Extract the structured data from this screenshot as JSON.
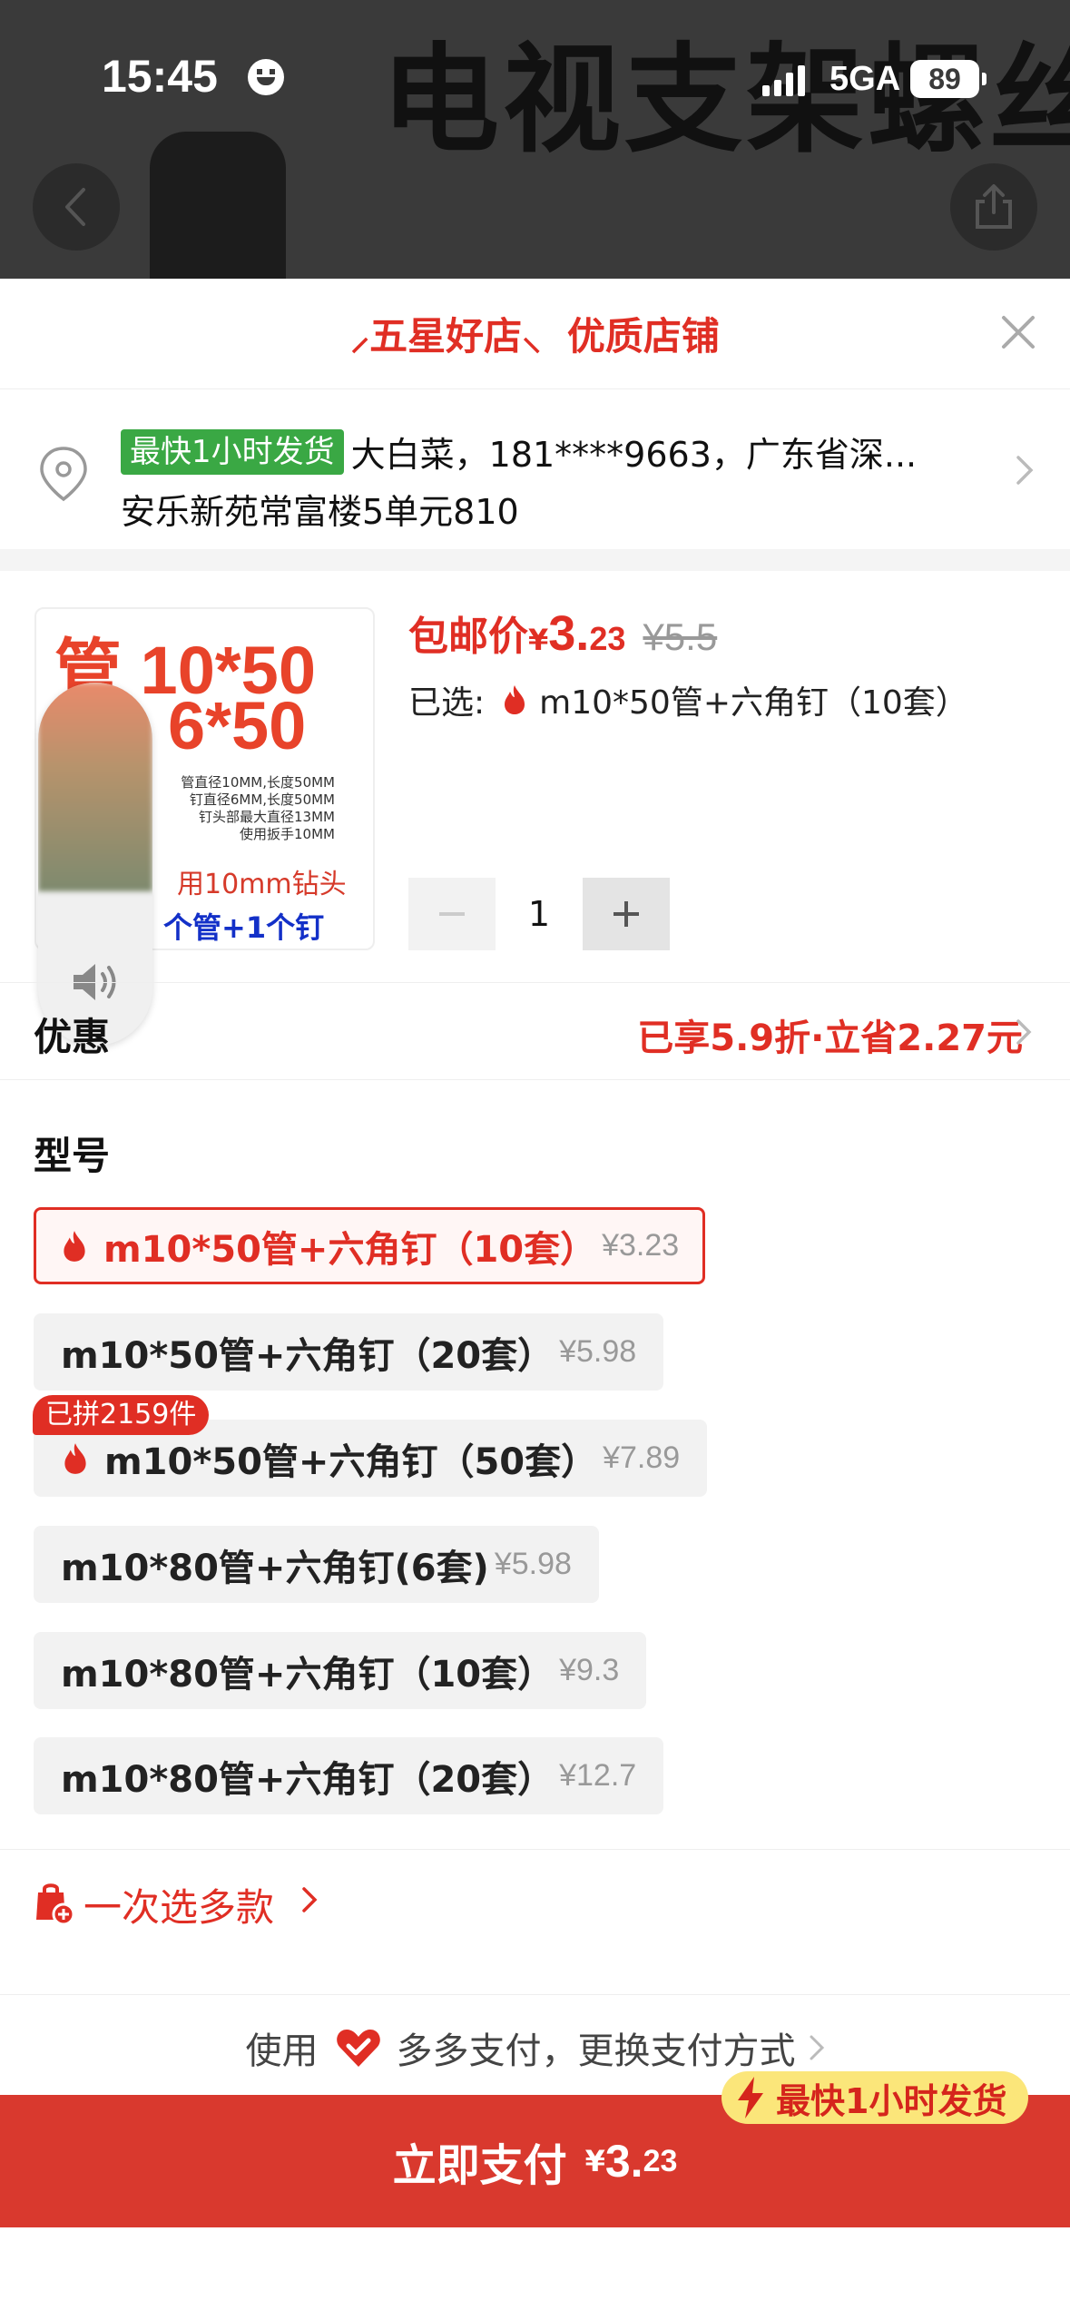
{
  "status_bar": {
    "time": "15:45",
    "network": "5GA",
    "battery": "89"
  },
  "background": {
    "title": "电视支架螺丝"
  },
  "colors": {
    "accent": "#e02e24",
    "pay_button": "#d9392e",
    "green_badge": "#3aa844",
    "fast_badge_bg": "#fbe67a"
  },
  "store": {
    "stars_label": "五星好店",
    "quality_label": "优质店铺"
  },
  "address": {
    "badge": "最快1小时发货",
    "line1": "大白菜，181****9663，广东省深...",
    "line2": "安乐新苑常富楼5单元810"
  },
  "product": {
    "image_text": {
      "big1": "管 10*50",
      "big2": "6*50",
      "spec": [
        "管直径10MM,长度50MM",
        "钉直径6MM,长度50MM",
        "钉头部最大直径13MM",
        "使用扳手10MM"
      ],
      "drill": "用10mm钻头",
      "combo": "个管+1个钉"
    },
    "price_label": "包邮价",
    "price_yen": "¥",
    "price_int": "3.",
    "price_dec": "23",
    "original_price": "¥5.5",
    "selected_prefix": "已选:",
    "selected_value": "m10*50管+六角钉（10套）",
    "quantity": "1"
  },
  "promo": {
    "label": "优惠",
    "value": "已享5.9折·立省2.27元"
  },
  "model": {
    "title": "型号",
    "sold_badge": "已拼2159件",
    "options": [
      {
        "label": "m10*50管+六角钉（10套）",
        "price": "¥3.23",
        "hot": true,
        "selected": true
      },
      {
        "label": "m10*50管+六角钉（20套）",
        "price": "¥5.98",
        "hot": false,
        "selected": false
      },
      {
        "label": "m10*50管+六角钉（50套）",
        "price": "¥7.89",
        "hot": true,
        "selected": false
      },
      {
        "label": "m10*80管+六角钉(6套)",
        "price": "¥5.98",
        "hot": false,
        "selected": false
      },
      {
        "label": "m10*80管+六角钉（10套）",
        "price": "¥9.3",
        "hot": false,
        "selected": false
      },
      {
        "label": "m10*80管+六角钉（20套）",
        "price": "¥12.7",
        "hot": false,
        "selected": false
      }
    ]
  },
  "multi_select": {
    "label": "一次选多款"
  },
  "payment": {
    "prefix": "使用",
    "method": "多多支付，更换支付方式",
    "fast_badge": "最快1小时发货",
    "pay_label": "立即支付",
    "pay_yen": "¥",
    "pay_int": "3.",
    "pay_dec": "23"
  }
}
